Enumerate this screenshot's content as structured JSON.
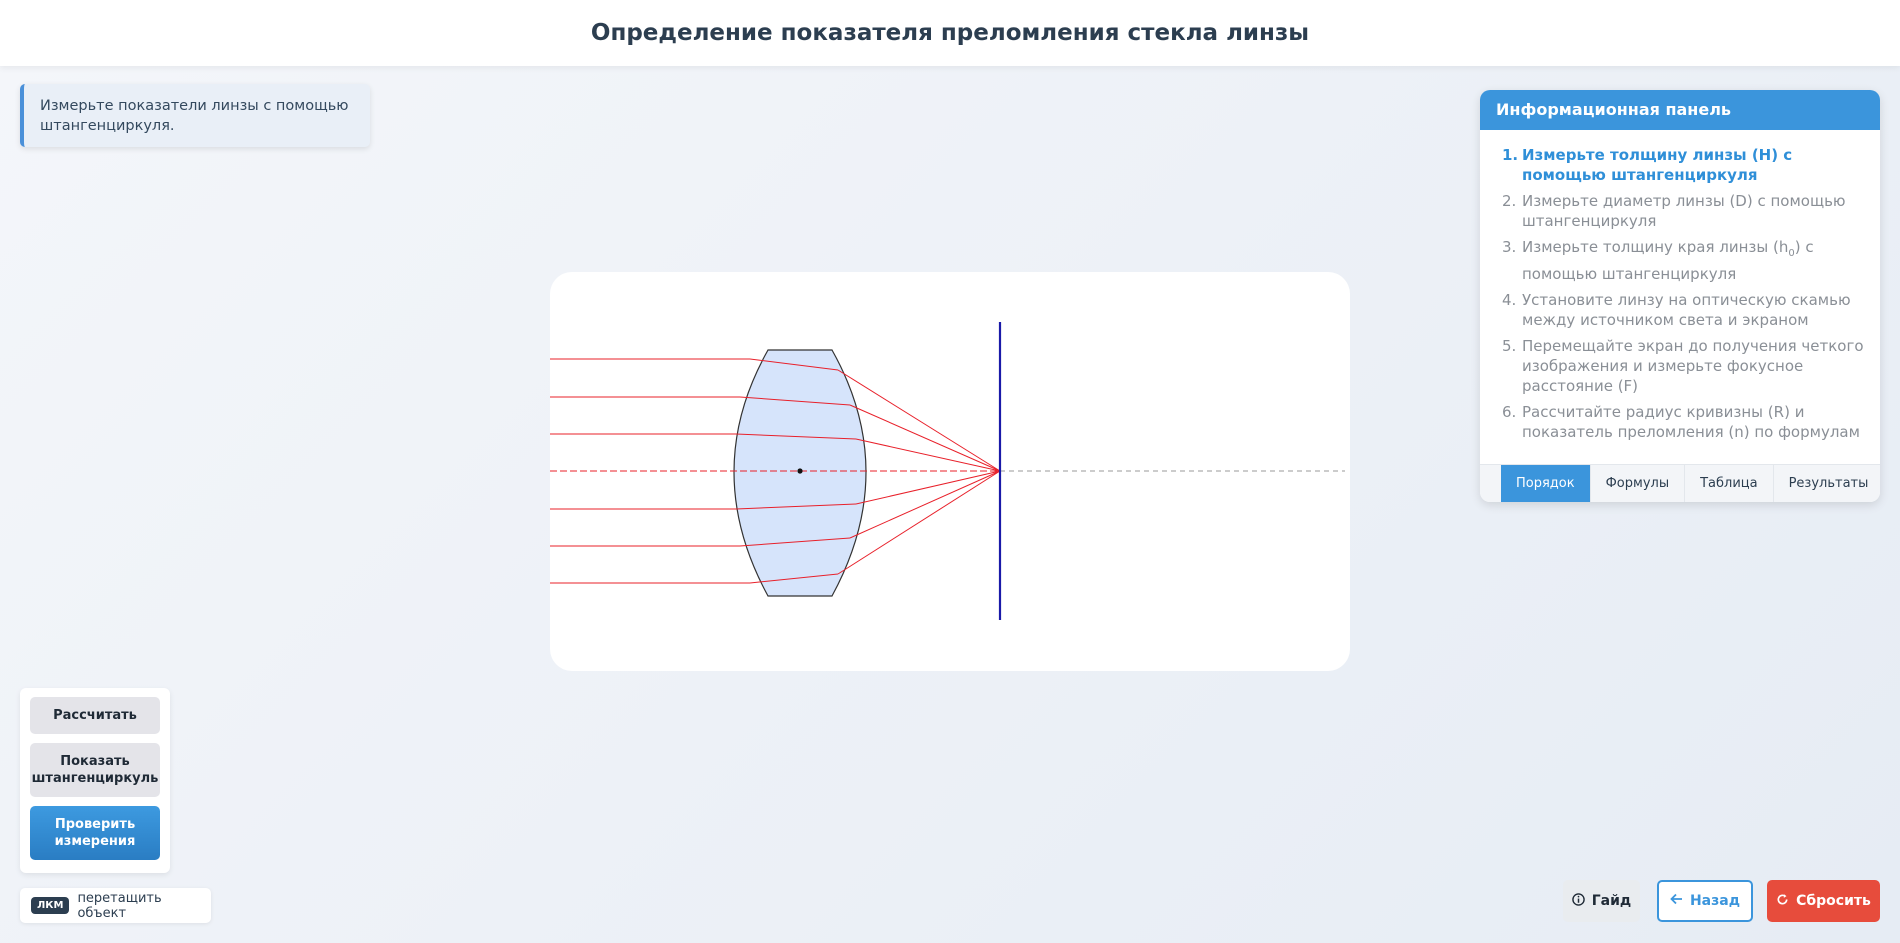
{
  "header": {
    "title": "Определение показателя преломления стекла линзы"
  },
  "hint": {
    "text": "Измерьте показатели линзы с помощью штангенциркуля."
  },
  "info_panel": {
    "title": "Информационная панель",
    "steps": [
      {
        "num": "1.",
        "text": "Измерьте толщину линзы (H) с помощью штангенциркуля"
      },
      {
        "num": "2.",
        "text": "Измерьте диаметр линзы (D) с помощью штангенциркуля"
      },
      {
        "num": "3.",
        "text_before": "Измерьте толщину края линзы (h",
        "sub": "0",
        "text_after": ") с помощью штангенциркуля"
      },
      {
        "num": "4.",
        "text": "Установите линзу на оптическую скамью между источником света и экраном"
      },
      {
        "num": "5.",
        "text": "Перемещайте экран до получения четкого изображения и измерьте фокусное расстояние (F)"
      },
      {
        "num": "6.",
        "text": "Рассчитайте радиус кривизны (R) и показатель преломления (n) по формулам"
      }
    ],
    "tabs": [
      "Порядок",
      "Формулы",
      "Таблица",
      "Результаты"
    ],
    "active_tab": "Порядок"
  },
  "controls": {
    "calculate": "Рассчитать",
    "show_caliper": "Показать штангенциркуль",
    "check_measurements": "Проверить измерения"
  },
  "mouse_hint": {
    "key": "ЛКМ",
    "text": "перетащить объект"
  },
  "buttons": {
    "guide": "Гайд",
    "back": "Назад",
    "reset": "Сбросить"
  },
  "colors": {
    "accent": "#3b95dc",
    "ray": "#e8202a",
    "screen": "#1a1aa8",
    "lens_fill": "#d6e4fb",
    "reset": "#e74c3c"
  }
}
